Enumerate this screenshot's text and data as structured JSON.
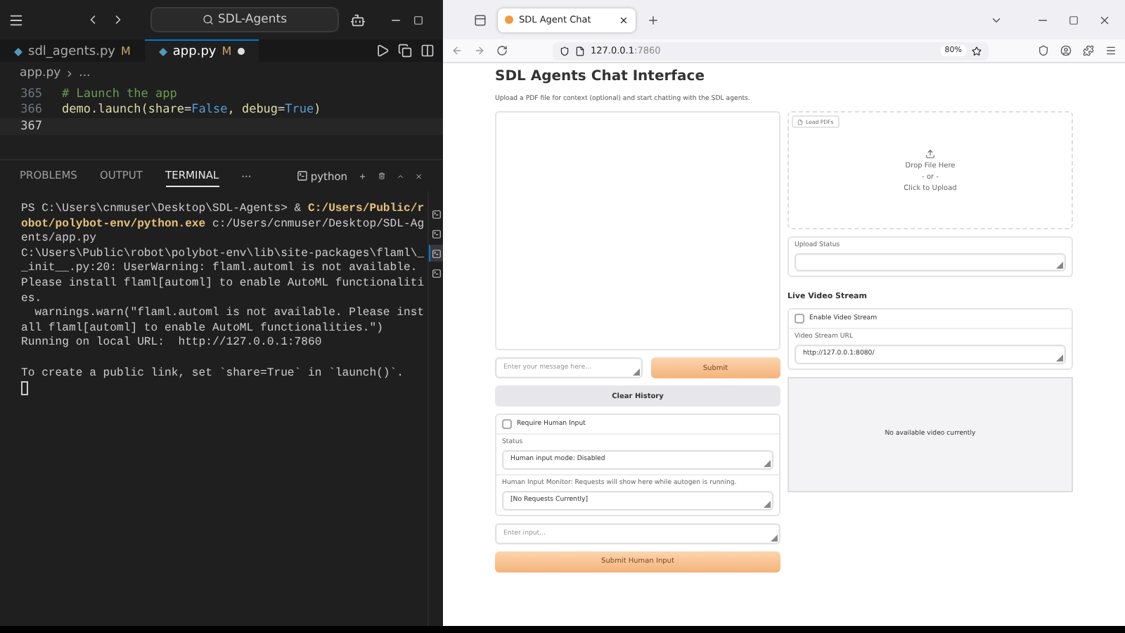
{
  "editor": {
    "search": "SDL-Agents",
    "tabs": [
      {
        "label": "sdl_agents.py",
        "badge": "M",
        "selected": false,
        "dirty": false
      },
      {
        "label": "app.py",
        "badge": "M",
        "selected": true,
        "dirty": true
      }
    ],
    "breadcrumb": {
      "file": "app.py",
      "rest": "..."
    },
    "code_lines": [
      {
        "number": "365",
        "current": false,
        "segments": [
          {
            "kind": "comment",
            "text": "# Launch the app"
          }
        ]
      },
      {
        "number": "366",
        "current": false,
        "segments": [
          {
            "kind": "plain",
            "text": "demo.launch(share"
          },
          {
            "kind": "operator",
            "text": "="
          },
          {
            "kind": "keyword",
            "text": "False"
          },
          {
            "kind": "plain",
            "text": ", debug"
          },
          {
            "kind": "operator",
            "text": "="
          },
          {
            "kind": "keyword",
            "text": "True"
          },
          {
            "kind": "plain",
            "text": ")"
          }
        ]
      },
      {
        "number": "367",
        "current": true
      }
    ],
    "panel_tabs": [
      {
        "label": "PROBLEMS",
        "selected": false
      },
      {
        "label": "OUTPUT",
        "selected": false
      },
      {
        "label": "TERMINAL",
        "selected": true
      }
    ],
    "more": "···",
    "terminal_name": "python",
    "terminal_lines": [
      {
        "segments": [
          {
            "kind": "plain",
            "text": "PS C:\\Users\\cnmuser\\Desktop\\SDL-Agents> & "
          },
          {
            "kind": "path",
            "text": "C:/Users/Public/r"
          }
        ]
      },
      {
        "segments": [
          {
            "kind": "path",
            "text": "obot/polybot-env/python.exe"
          },
          {
            "kind": "plain",
            "text": " c:/Users/cnmuser/Desktop/SDL-Ag"
          }
        ]
      },
      {
        "segments": [
          {
            "kind": "plain",
            "text": "ents/app.py"
          }
        ]
      },
      {
        "segments": [
          {
            "kind": "plain",
            "text": "C:\\Users\\Public\\robot\\polybot-env\\lib\\site-packages\\flaml\\_"
          }
        ]
      },
      {
        "segments": [
          {
            "kind": "plain",
            "text": "_init__.py:20: UserWarning: flaml.automl is not available."
          }
        ]
      },
      {
        "segments": [
          {
            "kind": "plain",
            "text": "Please install flaml[automl] to enable AutoML functionaliti"
          }
        ]
      },
      {
        "segments": [
          {
            "kind": "plain",
            "text": "es."
          }
        ]
      },
      {
        "segments": [
          {
            "kind": "plain",
            "text": "  warnings.warn(\"flaml.automl is not available. Please inst"
          }
        ]
      },
      {
        "segments": [
          {
            "kind": "plain",
            "text": "all flaml[automl] to enable AutoML functionalities.\")"
          }
        ]
      },
      {
        "segments": [
          {
            "kind": "plain",
            "text": "Running on local URL:  http://127.0.0.1:7860"
          }
        ]
      },
      {
        "blank_before": true,
        "segments": [
          {
            "kind": "plain",
            "text": "To create a public link, set `share=True` in `launch()`."
          }
        ]
      }
    ],
    "terminals": [
      {
        "selected": false
      },
      {
        "selected": false
      },
      {
        "selected": true
      },
      {
        "selected": false
      }
    ]
  },
  "browser": {
    "tab_title": "SDL Agent Chat",
    "url_host": "127.0.0.1",
    "url_port": ":7860",
    "zoom": "80%"
  },
  "page": {
    "title": "SDL Agents Chat Interface",
    "description": "Upload a PDF file for context (optional) and start chatting with the SDL agents.",
    "message_placeholder": "Enter your message here...",
    "submit": "Submit",
    "clear": "Clear History",
    "require_human_input": {
      "label": "Require Human Input",
      "checked": false
    },
    "status": {
      "label": "Status",
      "value": "Human input mode: Disabled"
    },
    "monitor": {
      "label": "Human Input Monitor: Requests will show here while autogen is running.",
      "value": "[No Requests Currently]"
    },
    "human_input_placeholder": "Enter input...",
    "submit_human": "Submit Human Input",
    "upload": {
      "badge": "Load PDFs",
      "drop": "Drop File Here",
      "or": "- or -",
      "click": "Click to Upload"
    },
    "upload_status": {
      "label": "Upload Status"
    },
    "video": {
      "heading": "Live Video Stream",
      "enable": {
        "label": "Enable Video Stream",
        "checked": false
      },
      "url_label": "Video Stream URL",
      "url_value": "http://127.0.0.1:8080/",
      "empty": "No available video currently"
    }
  }
}
